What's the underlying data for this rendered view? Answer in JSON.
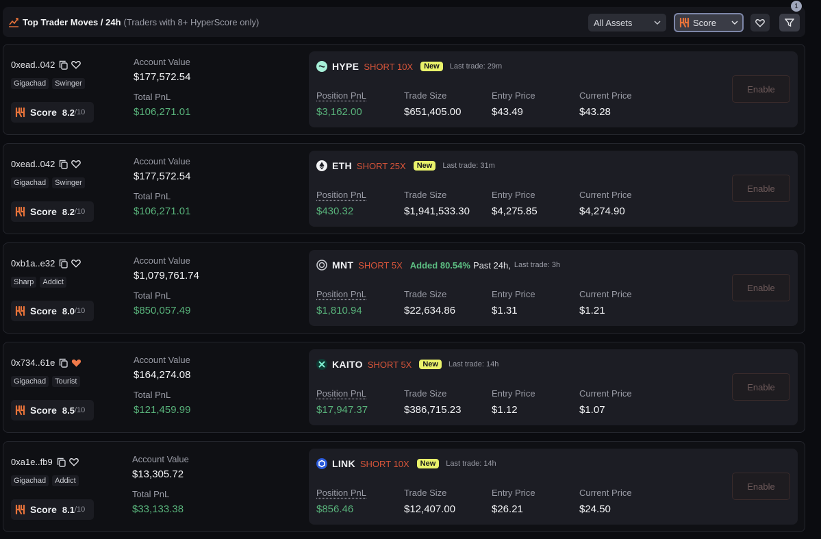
{
  "header": {
    "title": "Top Trader Moves / 24h",
    "subtitle": "(Traders with 8+ HyperScore only)",
    "assets_select": "All Assets",
    "score_select": "Score",
    "filter_badge": "1"
  },
  "labels": {
    "account_value": "Account Value",
    "total_pnl": "Total PnL",
    "score": "Score",
    "score_denominator": "/10",
    "position_pnl": "Position PnL",
    "trade_size": "Trade Size",
    "entry_price": "Entry Price",
    "current_price": "Current Price",
    "enable": "Enable",
    "new": "New"
  },
  "rows": [
    {
      "address": "0xead..042",
      "favorited": false,
      "tags": [
        "Gigachad",
        "Swinger"
      ],
      "score": "8.2",
      "account_value": "$177,572.54",
      "total_pnl": "$106,271.01",
      "ticker": "HYPE",
      "side": "SHORT 10X",
      "coin_icon": "hype-icon",
      "is_new": true,
      "last_trade": "Last trade: 29m",
      "position_pnl": "$3,162.00",
      "trade_size": "$651,405.00",
      "entry_price": "$43.49",
      "current_price": "$43.28"
    },
    {
      "address": "0xead..042",
      "favorited": false,
      "tags": [
        "Gigachad",
        "Swinger"
      ],
      "score": "8.2",
      "account_value": "$177,572.54",
      "total_pnl": "$106,271.01",
      "ticker": "ETH",
      "side": "SHORT 25X",
      "coin_icon": "eth-icon",
      "is_new": true,
      "last_trade": "Last trade: 31m",
      "position_pnl": "$430.32",
      "trade_size": "$1,941,533.30",
      "entry_price": "$4,275.85",
      "current_price": "$4,274.90"
    },
    {
      "address": "0xb1a..e32",
      "favorited": false,
      "tags": [
        "Sharp",
        "Addict"
      ],
      "score": "8.0",
      "account_value": "$1,079,761.74",
      "total_pnl": "$850,057.49",
      "ticker": "MNT",
      "side": "SHORT 5X",
      "coin_icon": "mnt-icon",
      "is_new": false,
      "added": "Added 80.54%",
      "past": "Past 24h,",
      "last_trade": "Last trade: 3h",
      "position_pnl": "$1,810.94",
      "trade_size": "$22,634.86",
      "entry_price": "$1.31",
      "current_price": "$1.21"
    },
    {
      "address": "0x734..61e",
      "favorited": true,
      "tags": [
        "Gigachad",
        "Tourist"
      ],
      "score": "8.5",
      "account_value": "$164,274.08",
      "total_pnl": "$121,459.99",
      "ticker": "KAITO",
      "side": "SHORT 5X",
      "coin_icon": "kaito-icon",
      "is_new": true,
      "last_trade": "Last trade: 14h",
      "position_pnl": "$17,947.37",
      "trade_size": "$386,715.23",
      "entry_price": "$1.12",
      "current_price": "$1.07"
    },
    {
      "address": "0xa1e..fb9",
      "favorited": false,
      "tags": [
        "Gigachad",
        "Addict"
      ],
      "score": "8.1",
      "account_value": "$13,305.72",
      "total_pnl": "$33,133.38",
      "ticker": "LINK",
      "side": "SHORT 10X",
      "coin_icon": "link-icon",
      "is_new": true,
      "last_trade": "Last trade: 14h",
      "position_pnl": "$856.46",
      "trade_size": "$12,407.00",
      "entry_price": "$26.21",
      "current_price": "$24.50"
    }
  ],
  "colors": {
    "background": "#0b0c10",
    "card": "#1c1d24",
    "positive": "#58b27a",
    "short": "#d9553a",
    "new_badge": "#e9f26a",
    "favorite": "#f07a4a",
    "brand": "#e8733a"
  }
}
